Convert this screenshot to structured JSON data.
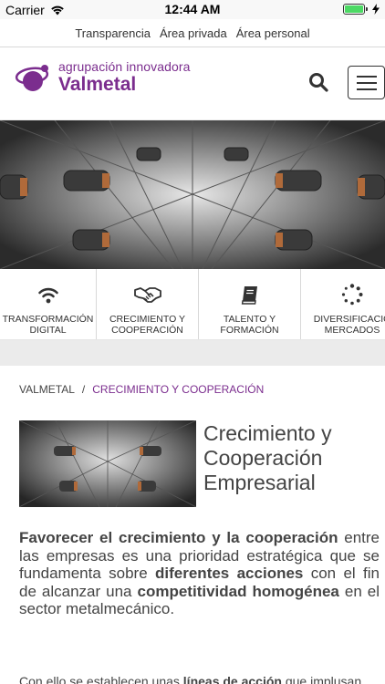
{
  "status_bar": {
    "carrier": "Carrier",
    "time": "12:44 AM"
  },
  "top_links": [
    "Transparencia",
    "Área privada",
    "Área personal"
  ],
  "logo": {
    "subtitle": "agrupación innovadora",
    "name": "Valmetal"
  },
  "colors": {
    "brand_purple": "#7b2d8e",
    "battery_green": "#4cd964"
  },
  "categories": [
    {
      "icon": "wifi-icon",
      "line1": "TRANSFORMACIÓN",
      "line2": "DIGITAL"
    },
    {
      "icon": "handshake-icon",
      "line1": "CRECIMIENTO Y",
      "line2": "COOPERACIÓN"
    },
    {
      "icon": "book-icon",
      "line1": "TALENTO Y",
      "line2": "FORMACIÓN"
    },
    {
      "icon": "spinner-icon",
      "line1": "DIVERSIFICACIÓ",
      "line2": "MERCADOS"
    }
  ],
  "breadcrumb": {
    "home": "VALMETAL",
    "separator": "/",
    "current": "CRECIMIENTO Y COOPERACIÓN"
  },
  "article": {
    "title": "Crecimiento y Cooperación Empresarial",
    "intro": {
      "b1": "Favorecer el crecimiento y la cooperación",
      "t1": " entre las empresas es una prioridad estratégica que se fundamenta sobre ",
      "b2": "diferentes acciones",
      "t2": " con el fin de alcanzar una ",
      "b3": "competitividad homogénea",
      "t3": " en el sector metalmecánico."
    },
    "body": {
      "t1": "Con ello se establecen unas ",
      "b1": "líneas de acción",
      "t2": " que implusan"
    }
  }
}
